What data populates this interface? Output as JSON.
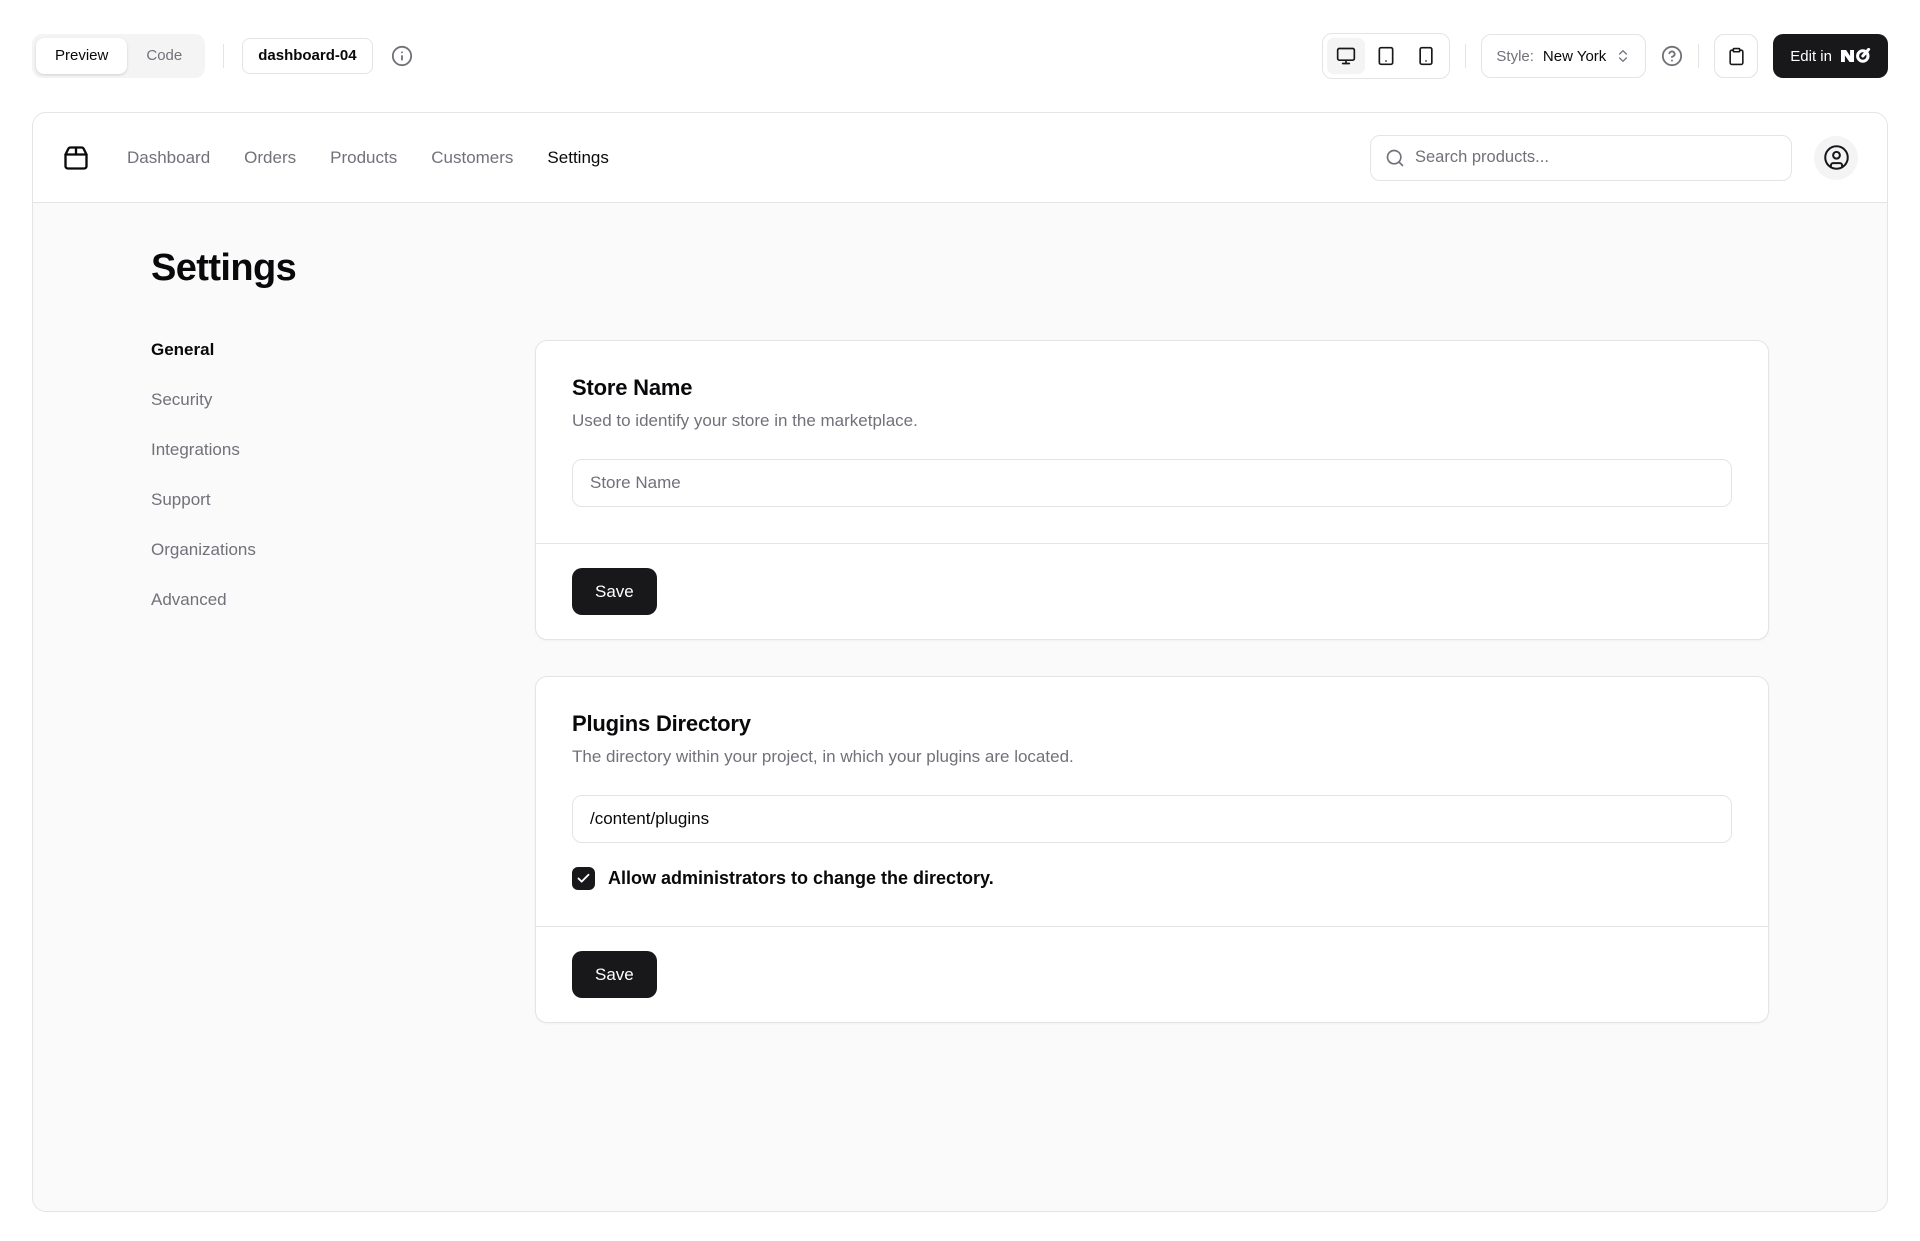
{
  "toolbar": {
    "preview_tab": "Preview",
    "code_tab": "Code",
    "block_badge": "dashboard-04",
    "style_label": "Style:",
    "style_value": "New York",
    "edit_in_label": "Edit in",
    "device_toggles": [
      "desktop",
      "tablet",
      "mobile"
    ]
  },
  "app": {
    "nav": {
      "items": [
        "Dashboard",
        "Orders",
        "Products",
        "Customers",
        "Settings"
      ],
      "active": "Settings"
    },
    "search_placeholder": "Search products...",
    "page_title": "Settings",
    "sidebar": {
      "items": [
        "General",
        "Security",
        "Integrations",
        "Support",
        "Organizations",
        "Advanced"
      ],
      "active": "General"
    },
    "cards": [
      {
        "title": "Store Name",
        "description": "Used to identify your store in the marketplace.",
        "input_placeholder": "Store Name",
        "save_label": "Save"
      },
      {
        "title": "Plugins Directory",
        "description": "The directory within your project, in which your plugins are located.",
        "input_value": "/content/plugins",
        "checkbox_label": "Allow administrators to change the directory.",
        "checkbox_checked": true,
        "save_label": "Save"
      }
    ]
  },
  "colors": {
    "foreground": "#09090b",
    "muted_foreground": "#71717a",
    "border": "#e4e4e7",
    "muted": "#f4f4f5",
    "page_muted": "#fafafa",
    "primary": "#18181b",
    "background": "#ffffff"
  }
}
